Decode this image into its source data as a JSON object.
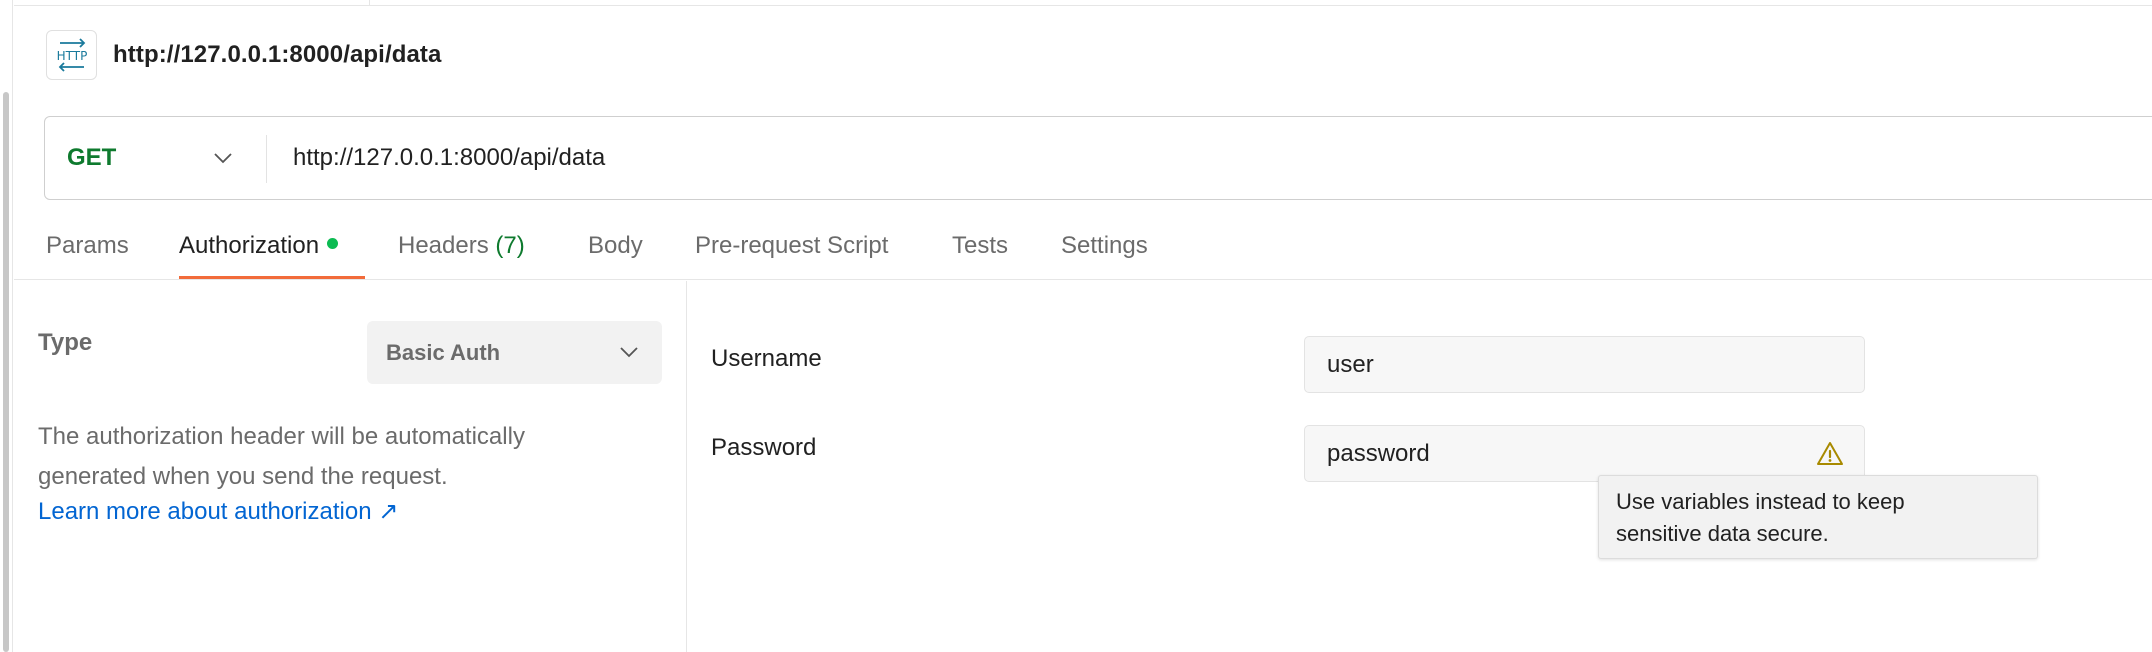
{
  "request": {
    "method_badge_icon": "http-icon",
    "name": "http://127.0.0.1:8000/api/data",
    "method": "GET",
    "method_color": "#0e7a2e",
    "url": "http://127.0.0.1:8000/api/data"
  },
  "tabs": [
    {
      "label": "Params"
    },
    {
      "label": "Authorization",
      "active": true,
      "indicator": "green-dot"
    },
    {
      "label": "Headers",
      "count": "(7)"
    },
    {
      "label": "Body"
    },
    {
      "label": "Pre-request Script"
    },
    {
      "label": "Tests"
    },
    {
      "label": "Settings"
    }
  ],
  "auth": {
    "type_label": "Type",
    "type_value": "Basic Auth",
    "description_line1": "The authorization header will be automatically",
    "description_line2": "generated when you send the request.",
    "learn_more": "Learn more about authorization ↗",
    "username_label": "Username",
    "username_value": "user",
    "password_label": "Password",
    "password_value": "password",
    "password_warning_icon": "warning-icon",
    "tooltip_line1": "Use variables instead to keep",
    "tooltip_line2": "sensitive data secure."
  },
  "colors": {
    "accent_tab": "#f26b3a",
    "active_dot": "#0cbb52",
    "link": "#0265d2",
    "warning": "#a88a00"
  }
}
